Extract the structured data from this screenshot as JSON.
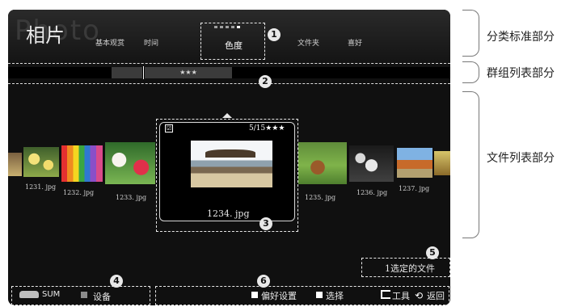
{
  "app": {
    "title": "相片",
    "watermark": "Photo"
  },
  "tabs": {
    "items": [
      "基本观赏",
      "时间",
      "色度",
      "文件夹",
      "喜好"
    ],
    "active": "色度"
  },
  "groups": {
    "items": [
      "",
      "★★★"
    ]
  },
  "files": {
    "names": [
      "1231. jpg",
      "1232. jpg",
      "1233. jpg",
      "1234. jpg",
      "1235. jpg",
      "1236. jpg",
      "1237. jpg"
    ],
    "focused": {
      "name": "1234. jpg",
      "count": "5/15★★★",
      "check": "☑"
    }
  },
  "status": {
    "selected": "1选定的文件"
  },
  "bottom": {
    "device_label": "SUM",
    "device_button": "设备",
    "pref": "偏好设置",
    "select": "选择",
    "tools": "工具",
    "return": "返回"
  },
  "markers": [
    "1",
    "2",
    "3",
    "4",
    "5",
    "6"
  ],
  "annotations": [
    "分类标准部分",
    "群组列表部分",
    "文件列表部分"
  ],
  "colors": {
    "screen": "#101010",
    "text": "#e8e8e8",
    "frame": "#777777"
  }
}
